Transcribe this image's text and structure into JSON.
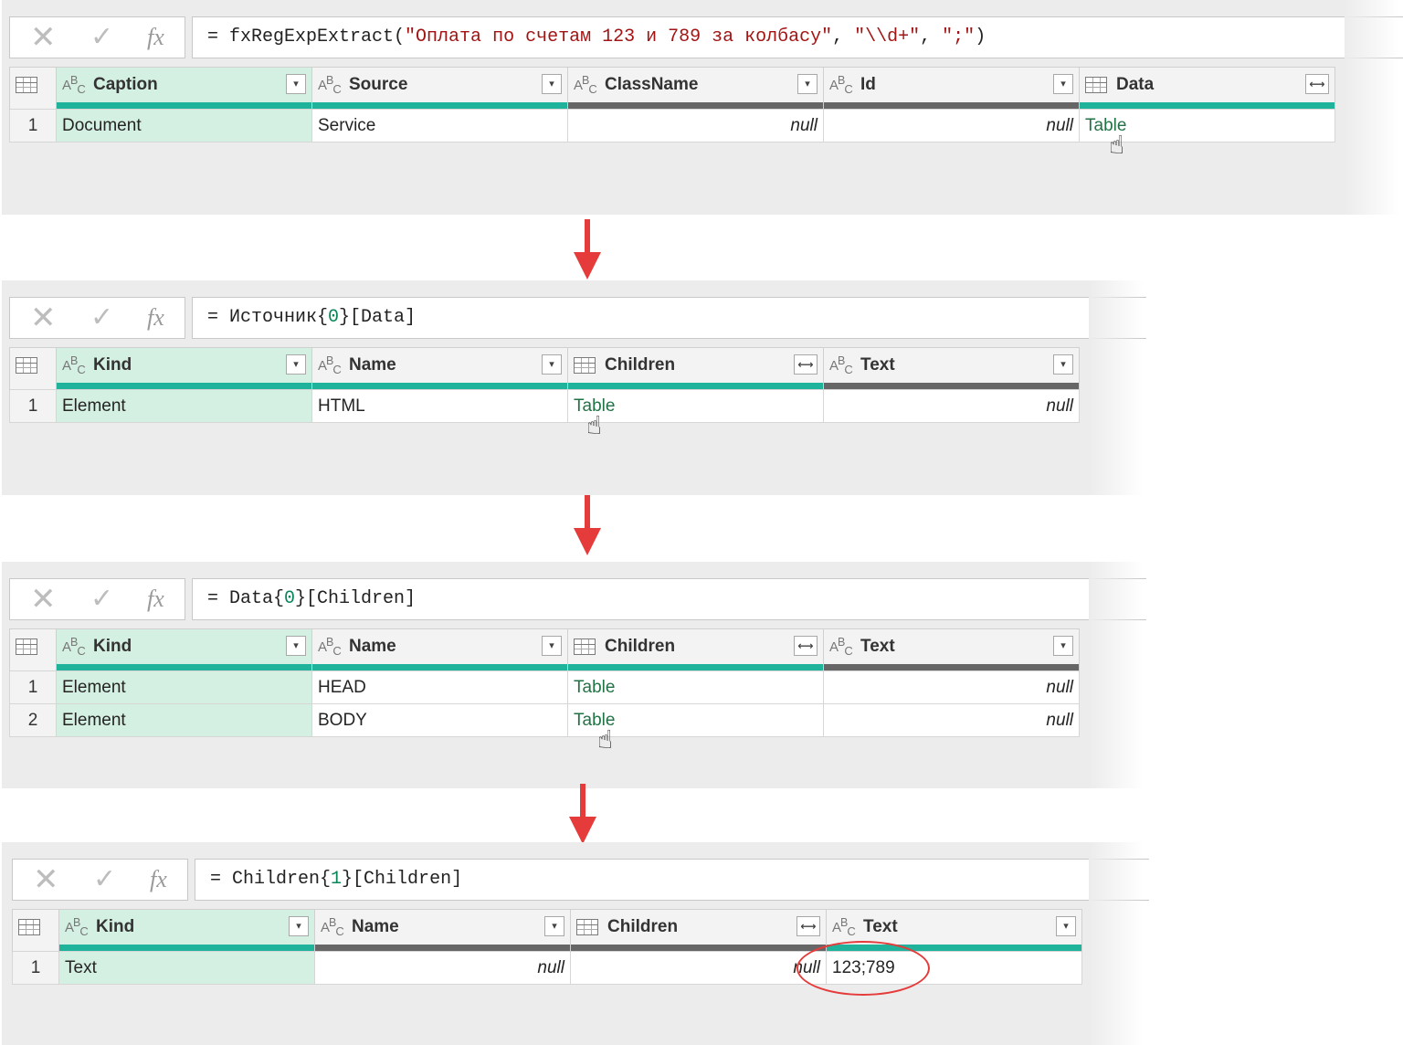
{
  "steps": [
    {
      "formula": {
        "prefix": "= fxRegExpExtract(",
        "s1": "\"Оплата по счетам 123 и 789 за колбасу\"",
        "sep1": ", ",
        "s2": "\"\\\\d+\"",
        "sep2": ", ",
        "s3": "\";\"",
        "suffix": ")"
      },
      "columns": [
        {
          "type": "ABC",
          "name": "Caption",
          "control": "dropdown"
        },
        {
          "type": "ABC",
          "name": "Source",
          "control": "dropdown"
        },
        {
          "type": "ABC",
          "name": "ClassName",
          "control": "dropdown"
        },
        {
          "type": "ABC",
          "name": "Id",
          "control": "dropdown"
        },
        {
          "type": "table",
          "name": "Data",
          "control": "expand"
        }
      ],
      "rows": [
        {
          "n": "1",
          "cells": [
            "Document",
            "Service",
            "null",
            "null",
            "Table"
          ]
        }
      ]
    },
    {
      "formula": {
        "prefix": "= Источник{",
        "num": "0",
        "suffix": "}[Data]"
      },
      "columns": [
        {
          "type": "ABC",
          "name": "Kind",
          "control": "dropdown"
        },
        {
          "type": "ABC",
          "name": "Name",
          "control": "dropdown"
        },
        {
          "type": "table",
          "name": "Children",
          "control": "expand"
        },
        {
          "type": "ABC",
          "name": "Text",
          "control": "dropdown"
        }
      ],
      "rows": [
        {
          "n": "1",
          "cells": [
            "Element",
            "HTML",
            "Table",
            "null"
          ]
        }
      ]
    },
    {
      "formula": {
        "prefix": "= Data{",
        "num": "0",
        "suffix": "}[Children]"
      },
      "columns": [
        {
          "type": "ABC",
          "name": "Kind",
          "control": "dropdown"
        },
        {
          "type": "ABC",
          "name": "Name",
          "control": "dropdown"
        },
        {
          "type": "table",
          "name": "Children",
          "control": "expand"
        },
        {
          "type": "ABC",
          "name": "Text",
          "control": "dropdown"
        }
      ],
      "rows": [
        {
          "n": "1",
          "cells": [
            "Element",
            "HEAD",
            "Table",
            "null"
          ]
        },
        {
          "n": "2",
          "cells": [
            "Element",
            "BODY",
            "Table",
            "null"
          ]
        }
      ]
    },
    {
      "formula": {
        "prefix": "= Children{",
        "num": "1",
        "suffix": "}[Children]"
      },
      "columns": [
        {
          "type": "ABC",
          "name": "Kind",
          "control": "dropdown"
        },
        {
          "type": "ABC",
          "name": "Name",
          "control": "dropdown"
        },
        {
          "type": "table",
          "name": "Children",
          "control": "expand"
        },
        {
          "type": "ABC",
          "name": "Text",
          "control": "dropdown"
        }
      ],
      "rows": [
        {
          "n": "1",
          "cells": [
            "Text",
            "null",
            "null",
            "123;789"
          ]
        }
      ]
    }
  ],
  "icons": {
    "cancel": "✕",
    "confirm": "✓",
    "fx": "fx",
    "dropdown": "▾",
    "expand": "⟷"
  }
}
